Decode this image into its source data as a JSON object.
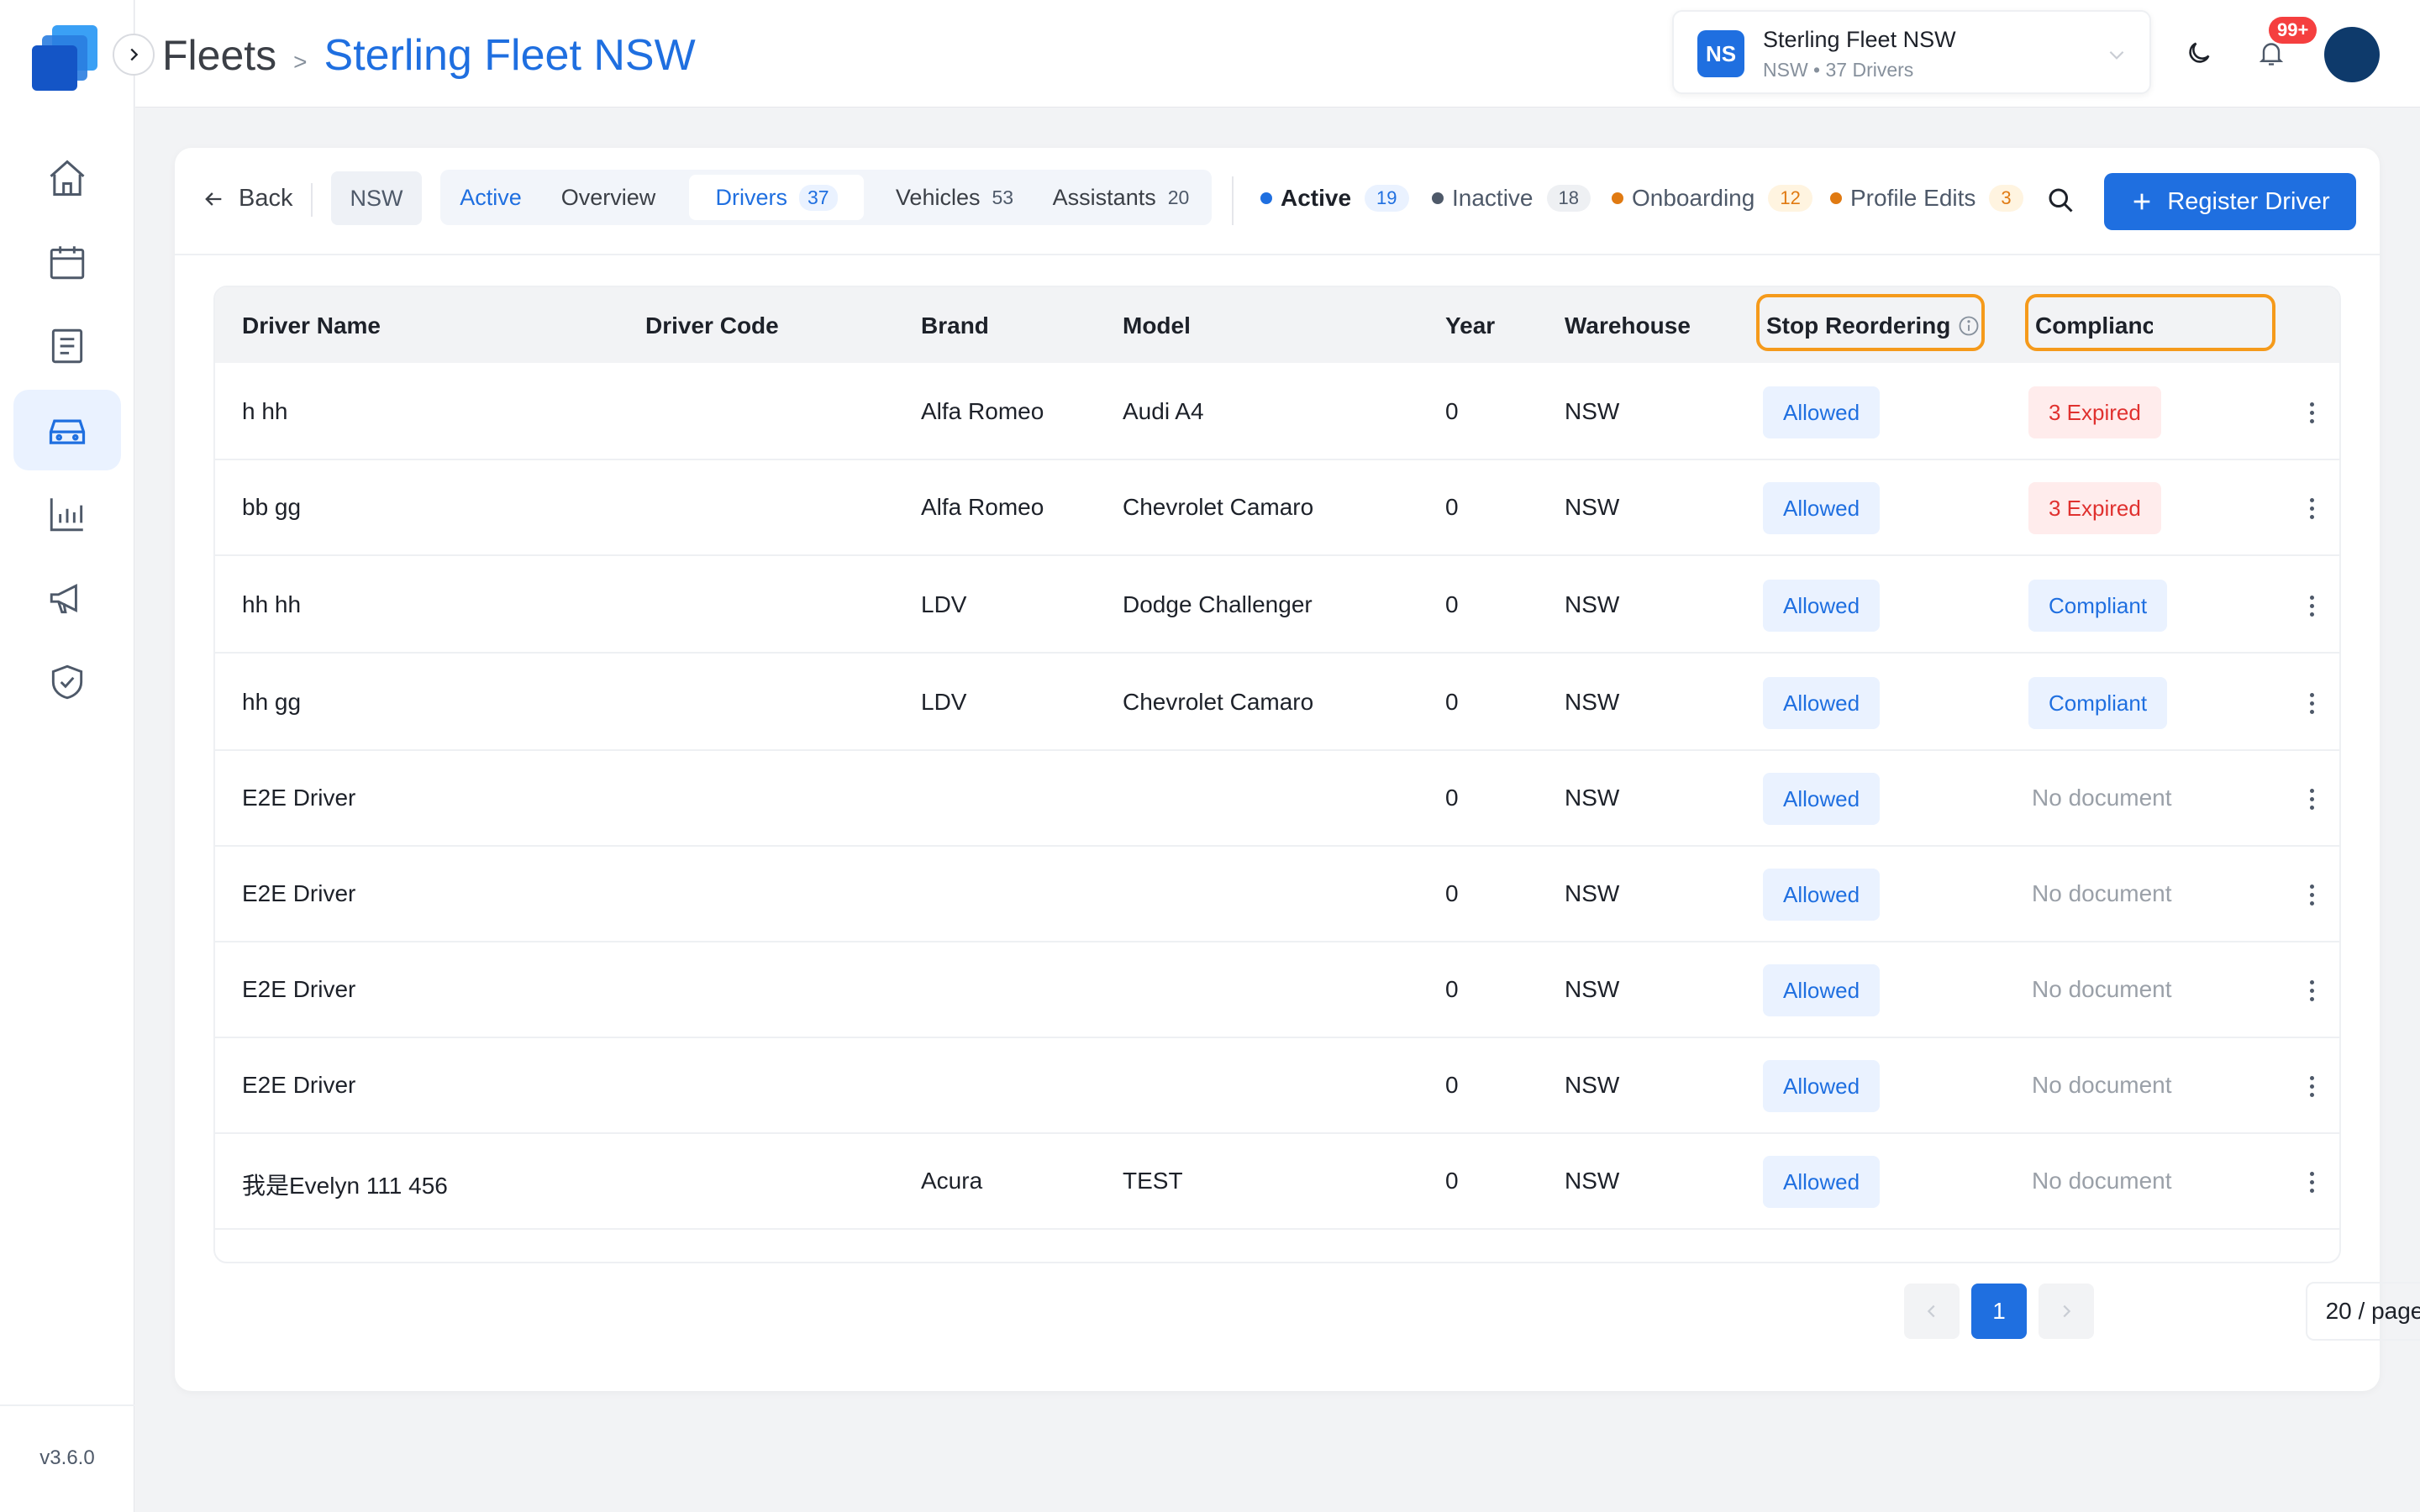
{
  "app": {
    "version": "v3.6.0"
  },
  "header": {
    "breadcrumb_root": "Fleets",
    "breadcrumb_sep": ">",
    "breadcrumb_current": "Sterling Fleet NSW",
    "fleet_switcher": {
      "initials": "NS",
      "name": "Sterling Fleet NSW",
      "subtitle": "NSW • 37 Drivers"
    },
    "notification_badge": "99+"
  },
  "sidebar": {
    "items": [
      {
        "icon": "home-icon",
        "active": false
      },
      {
        "icon": "calendar-icon",
        "active": false
      },
      {
        "icon": "document-icon",
        "active": false
      },
      {
        "icon": "car-icon",
        "active": true
      },
      {
        "icon": "bar-chart-icon",
        "active": false
      },
      {
        "icon": "megaphone-icon",
        "active": false
      },
      {
        "icon": "shield-check-icon",
        "active": false
      }
    ]
  },
  "filterbar": {
    "back_label": "Back",
    "region_chip": "NSW",
    "tabs": [
      {
        "label": "Active",
        "count": ""
      },
      {
        "label": "Overview",
        "count": ""
      },
      {
        "label": "Drivers",
        "count": "37"
      },
      {
        "label": "Vehicles",
        "count": "53"
      },
      {
        "label": "Assistants",
        "count": "20"
      }
    ],
    "statuses": [
      {
        "label": "Active",
        "count": "19",
        "color": "#1f6fe0"
      },
      {
        "label": "Inactive",
        "count": "18",
        "color": "#4e5969"
      },
      {
        "label": "Onboarding",
        "count": "12",
        "color": "#e07a12"
      },
      {
        "label": "Profile Edits",
        "count": "3",
        "color": "#e07a12"
      }
    ],
    "register_label": "Register Driver"
  },
  "table": {
    "columns": [
      "Driver Name",
      "Driver Code",
      "Brand",
      "Model",
      "Year",
      "Warehouse",
      "Stop Reordering",
      "Compliance S"
    ],
    "rows": [
      {
        "name": "h hh",
        "code": "",
        "brand": "Alfa Romeo",
        "model": "Audi A4",
        "year": "0",
        "warehouse": "NSW",
        "stop": "Allowed",
        "compliance": "3 Expired",
        "compliance_type": "expired"
      },
      {
        "name": "bb gg",
        "code": "",
        "brand": "Alfa Romeo",
        "model": "Chevrolet Camaro",
        "year": "0",
        "warehouse": "NSW",
        "stop": "Allowed",
        "compliance": "3 Expired",
        "compliance_type": "expired"
      },
      {
        "name": "hh hh",
        "code": "",
        "brand": "LDV",
        "model": "Dodge Challenger",
        "year": "0",
        "warehouse": "NSW",
        "stop": "Allowed",
        "compliance": "Compliant",
        "compliance_type": "compliant"
      },
      {
        "name": "hh gg",
        "code": "",
        "brand": "LDV",
        "model": "Chevrolet Camaro",
        "year": "0",
        "warehouse": "NSW",
        "stop": "Allowed",
        "compliance": "Compliant",
        "compliance_type": "compliant"
      },
      {
        "name": "E2E Driver",
        "code": "",
        "brand": "",
        "model": "",
        "year": "0",
        "warehouse": "NSW",
        "stop": "Allowed",
        "compliance": "No document",
        "compliance_type": "none"
      },
      {
        "name": "E2E Driver",
        "code": "",
        "brand": "",
        "model": "",
        "year": "0",
        "warehouse": "NSW",
        "stop": "Allowed",
        "compliance": "No document",
        "compliance_type": "none"
      },
      {
        "name": "E2E Driver",
        "code": "",
        "brand": "",
        "model": "",
        "year": "0",
        "warehouse": "NSW",
        "stop": "Allowed",
        "compliance": "No document",
        "compliance_type": "none"
      },
      {
        "name": "E2E Driver",
        "code": "",
        "brand": "",
        "model": "",
        "year": "0",
        "warehouse": "NSW",
        "stop": "Allowed",
        "compliance": "No document",
        "compliance_type": "none"
      },
      {
        "name": "我是Evelyn 111 456",
        "code": "",
        "brand": "Acura",
        "model": "TEST",
        "year": "0",
        "warehouse": "NSW",
        "stop": "Allowed",
        "compliance": "No document",
        "compliance_type": "none"
      }
    ]
  },
  "pagination": {
    "current_page": "1",
    "page_size_label": "20 / page"
  }
}
